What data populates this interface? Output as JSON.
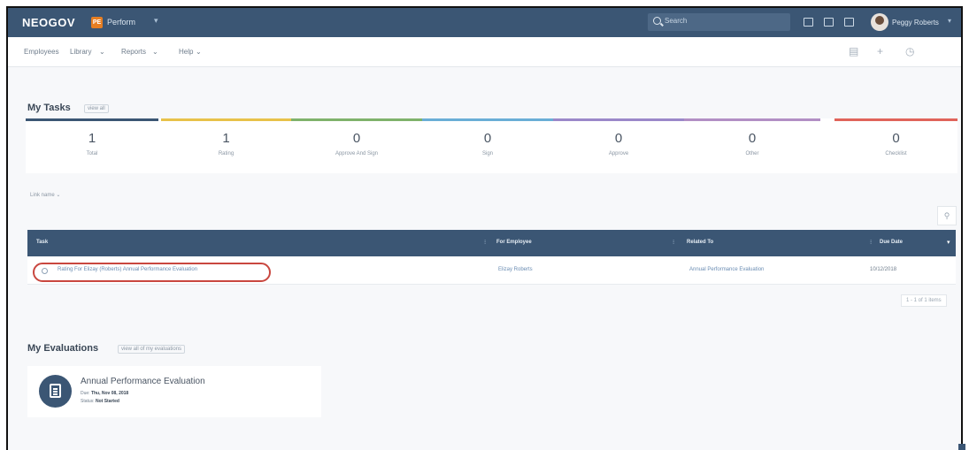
{
  "topbar": {
    "brand": "NEOGOV",
    "product_badge": "PE",
    "product_name": "Perform",
    "product_caret": "▾",
    "search_placeholder": "Search",
    "icons": [
      "calendar-icon",
      "grid-icon",
      "list-icon"
    ],
    "user_name": "Peggy Roberts",
    "user_caret": "▾"
  },
  "subnav": {
    "items": [
      "Employees",
      "Library",
      "Reports",
      "Help"
    ],
    "right_icons": [
      "document-icon",
      "plus-icon",
      "clock-icon"
    ],
    "plus": "+",
    "clock": "◷",
    "doc": "▤"
  },
  "tasks": {
    "title": "My Tasks",
    "view_all": "view all",
    "tiles": [
      {
        "count": "1",
        "label": "Total",
        "color": "#3b5674"
      },
      {
        "count": "1",
        "label": "Rating",
        "color": "#e8c24a"
      },
      {
        "count": "0",
        "label": "Approve And Sign",
        "color": "#7fb26b"
      },
      {
        "count": "0",
        "label": "Sign",
        "color": "#6aaed6"
      },
      {
        "count": "0",
        "label": "Approve",
        "color": "#9b88c9"
      },
      {
        "count": "0",
        "label": "Other",
        "color": "#b28fc4"
      },
      {
        "count": "0",
        "label": "Checklist",
        "color": "#e0645a"
      }
    ],
    "filter": "Link name",
    "table": {
      "columns": [
        "Task",
        "For Employee",
        "Related To",
        "Due Date"
      ],
      "rows": [
        {
          "task": "Rating For Elizay (Roberts) Annual Performance Evaluation",
          "employee": "Elizay Roberts",
          "related": "Annual Performance Evaluation",
          "due": "10/12/2018"
        }
      ]
    },
    "pager": "1 - 1 of 1 items"
  },
  "evaluations": {
    "title": "My Evaluations",
    "view_all": "view all of my evaluations",
    "card": {
      "title": "Annual Performance Evaluation",
      "due_label": "Due:",
      "due_value": "Thu, Nov 08, 2018",
      "status_label": "Status:",
      "status_value": "Not Started"
    }
  }
}
